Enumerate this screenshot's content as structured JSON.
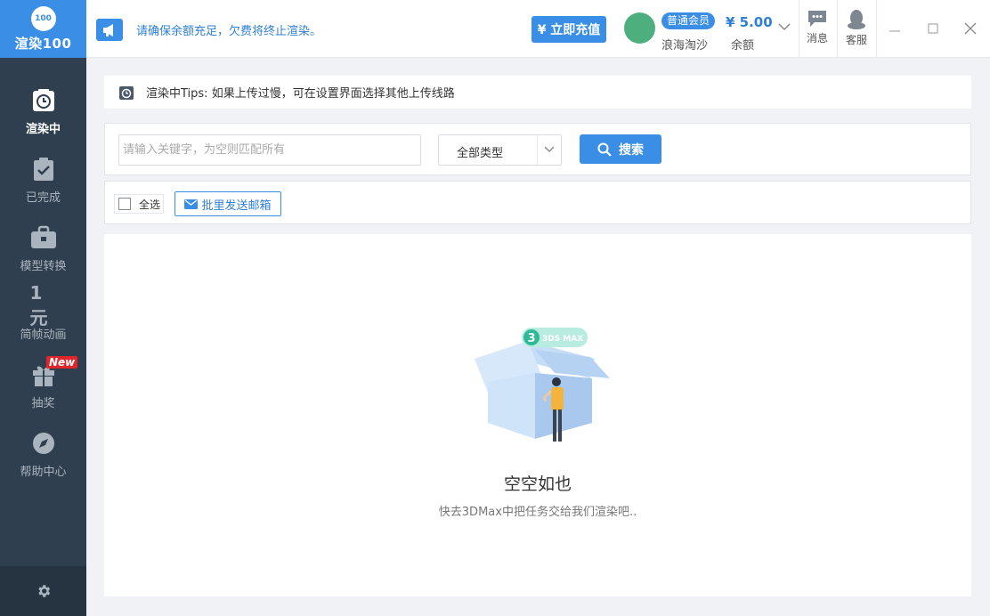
{
  "app": {
    "logo_mark": "100",
    "logo_text": "渲染100"
  },
  "sidebar": {
    "items": [
      {
        "label": "渲染中",
        "icon": "clock-icon",
        "active": true
      },
      {
        "label": "已完成",
        "icon": "clipboard-check-icon",
        "active": false
      },
      {
        "label": "模型转换",
        "icon": "briefcase-icon",
        "active": false
      },
      {
        "label": "简帧动画",
        "icon": "one-yuan-icon",
        "icon_text": "1元",
        "active": false
      },
      {
        "label": "抽奖",
        "icon": "gift-icon",
        "badge": "New",
        "active": false
      },
      {
        "label": "帮助中心",
        "icon": "compass-icon",
        "active": false
      }
    ],
    "settings_icon": "gear-icon"
  },
  "header": {
    "notice_text": "请确保余额充足，欠费将终止渲染。",
    "recharge_label": "¥ 立即充值",
    "member_badge": "普通会员",
    "username": "浪海淘沙",
    "balance_amount": "¥ 5.00",
    "balance_label": "余额",
    "message_label": "消息",
    "service_label": "客服"
  },
  "tips": {
    "text": "渲染中Tips: 如果上传过慢，可在设置界面选择其他上传线路"
  },
  "search": {
    "placeholder": "请输入关键字，为空则匹配所有",
    "value": "",
    "type_selected": "全部类型",
    "button_label": "搜索"
  },
  "actions": {
    "select_all_label": "全选",
    "batch_mail_label": "批里发送邮箱"
  },
  "empty": {
    "badge_text": "3DS MAX",
    "badge_num": "3",
    "title": "空空如也",
    "subtitle": "快去3DMax中把任务交给我们渲染吧.."
  },
  "colors": {
    "accent": "#3a8ee6",
    "sidebar_bg": "#2f3f4f",
    "avatar": "#4caf7d",
    "new_badge": "#e0262b",
    "max_badge": "#5fd1b8"
  }
}
